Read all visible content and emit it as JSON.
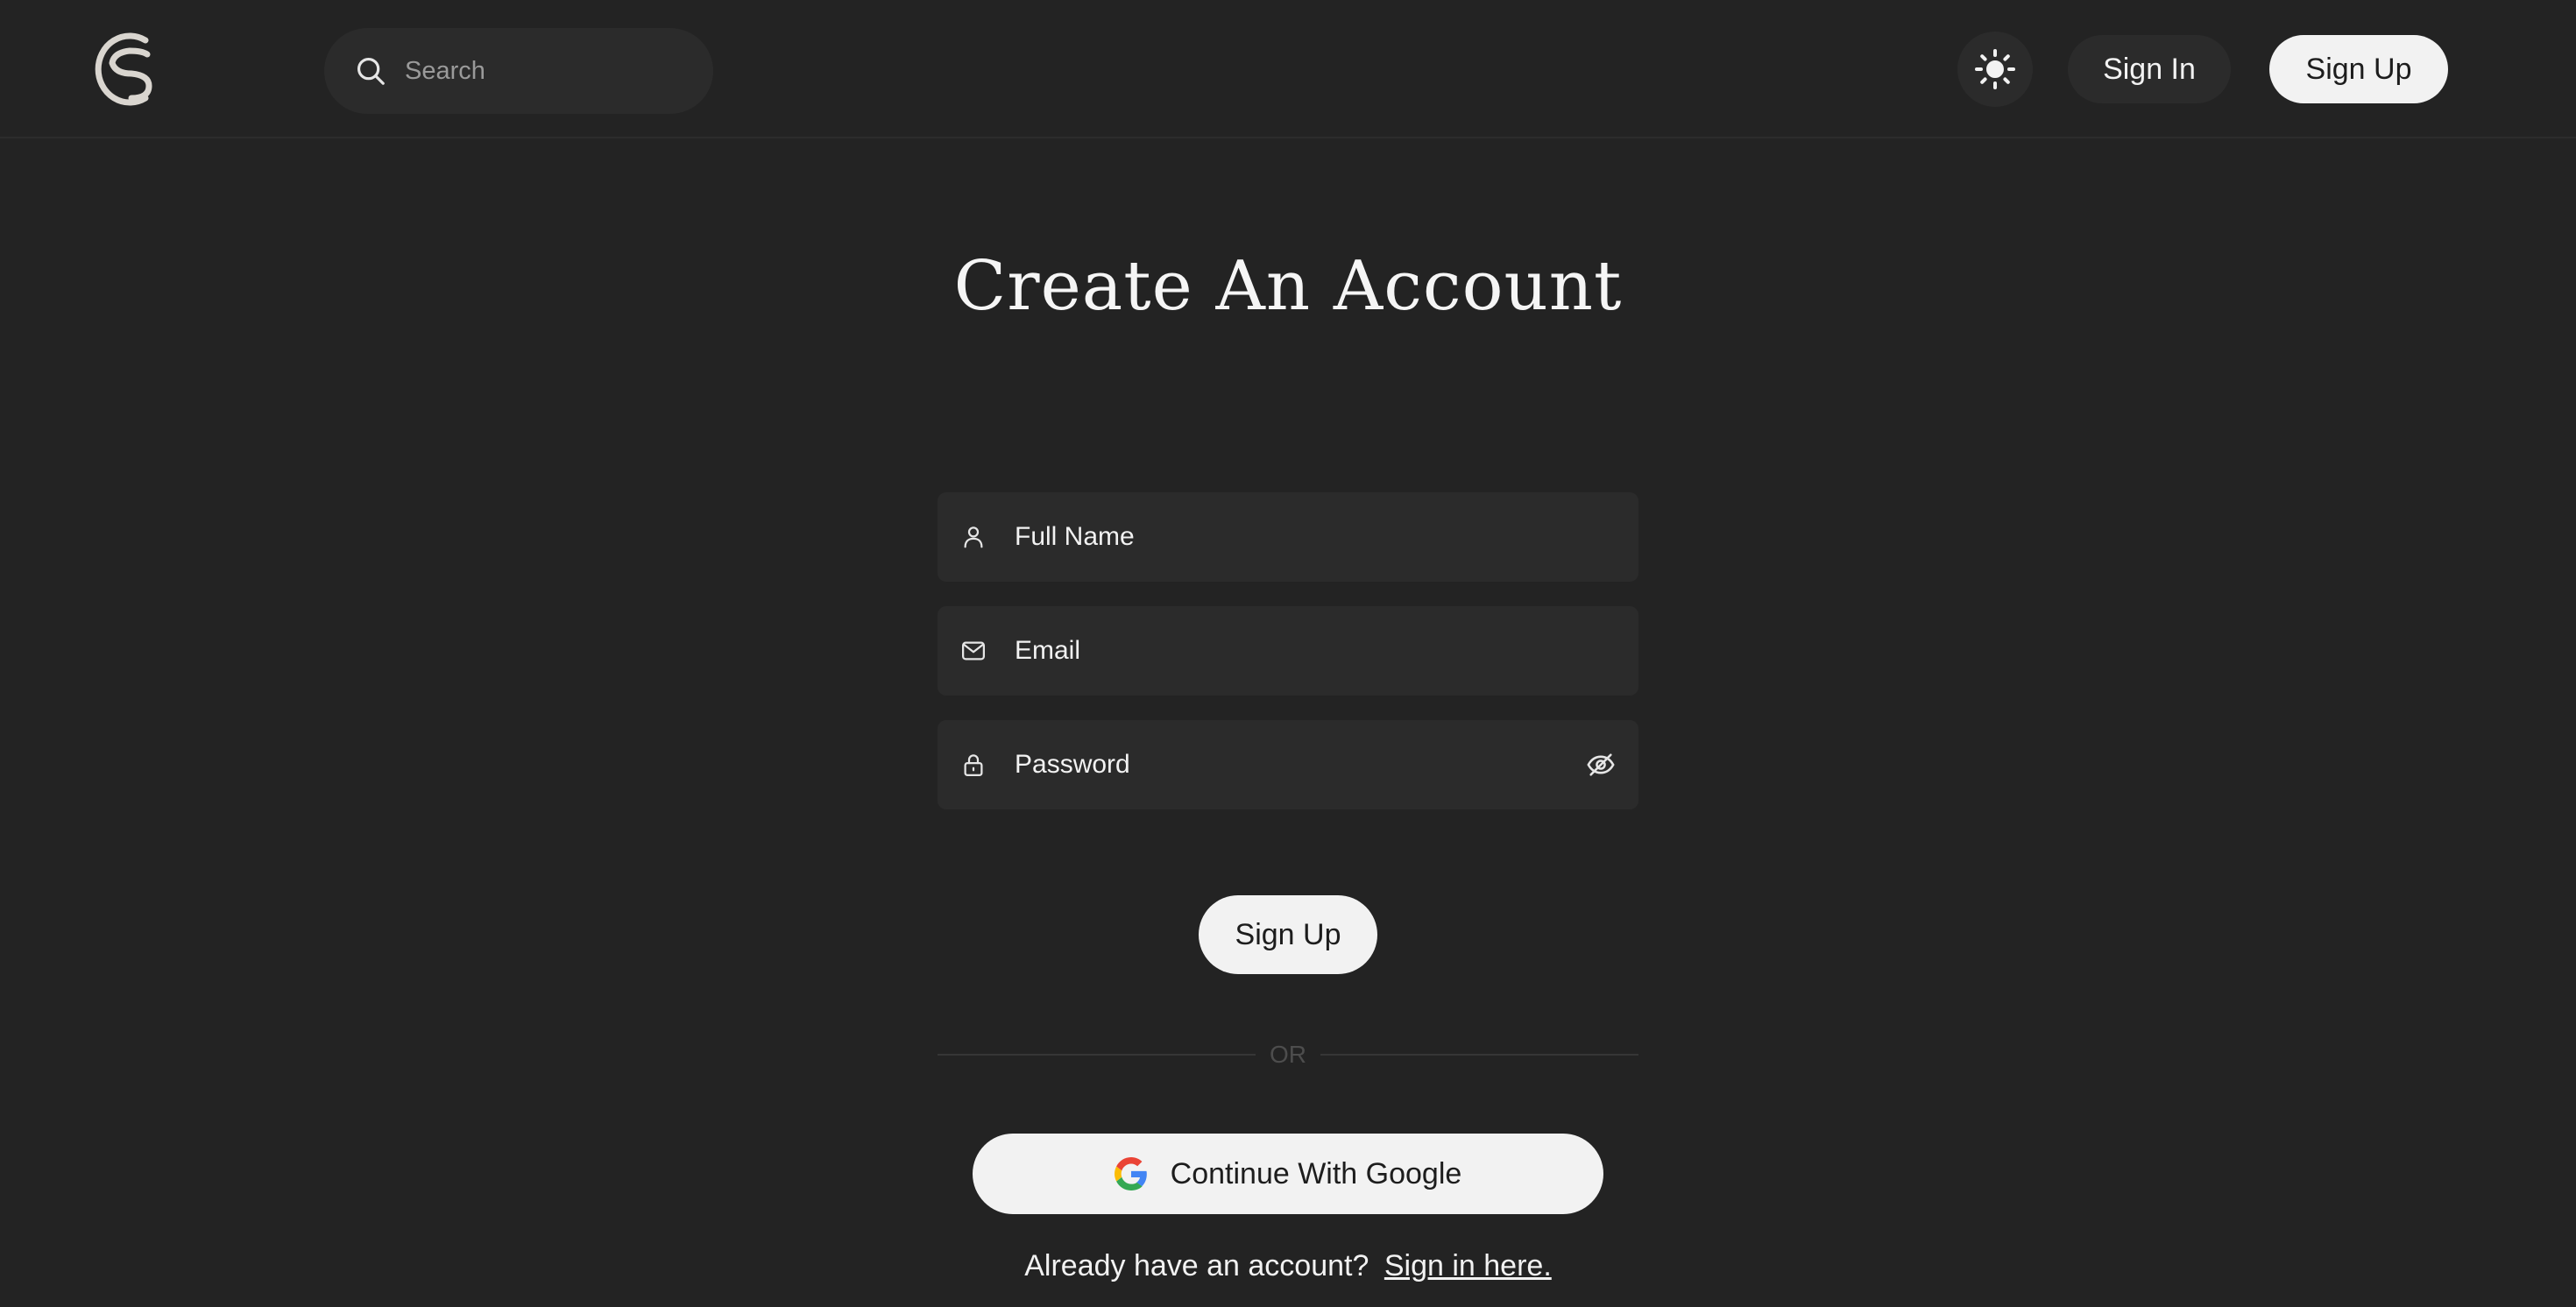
{
  "header": {
    "logo_icon": "cs-logo-icon",
    "search": {
      "placeholder": "Search",
      "icon": "search-icon"
    },
    "theme_toggle_icon": "sun-icon",
    "signin_label": "Sign In",
    "signup_label": "Sign Up"
  },
  "main": {
    "title": "Create An Account",
    "fields": {
      "full_name": {
        "placeholder": "Full Name",
        "icon": "user-icon"
      },
      "email": {
        "placeholder": "Email",
        "icon": "mail-icon"
      },
      "password": {
        "placeholder": "Password",
        "icon": "lock-icon",
        "toggle_icon": "eye-off-icon"
      }
    },
    "submit_label": "Sign Up",
    "divider_text": "OR",
    "google_label": "Continue With Google",
    "footer": {
      "prompt": "Already have an account?",
      "link": "Sign in here."
    }
  },
  "colors": {
    "background": "#232323",
    "surface": "#2b2b2b",
    "button_light": "#f2f2f2",
    "text": "#f2f2f2"
  }
}
